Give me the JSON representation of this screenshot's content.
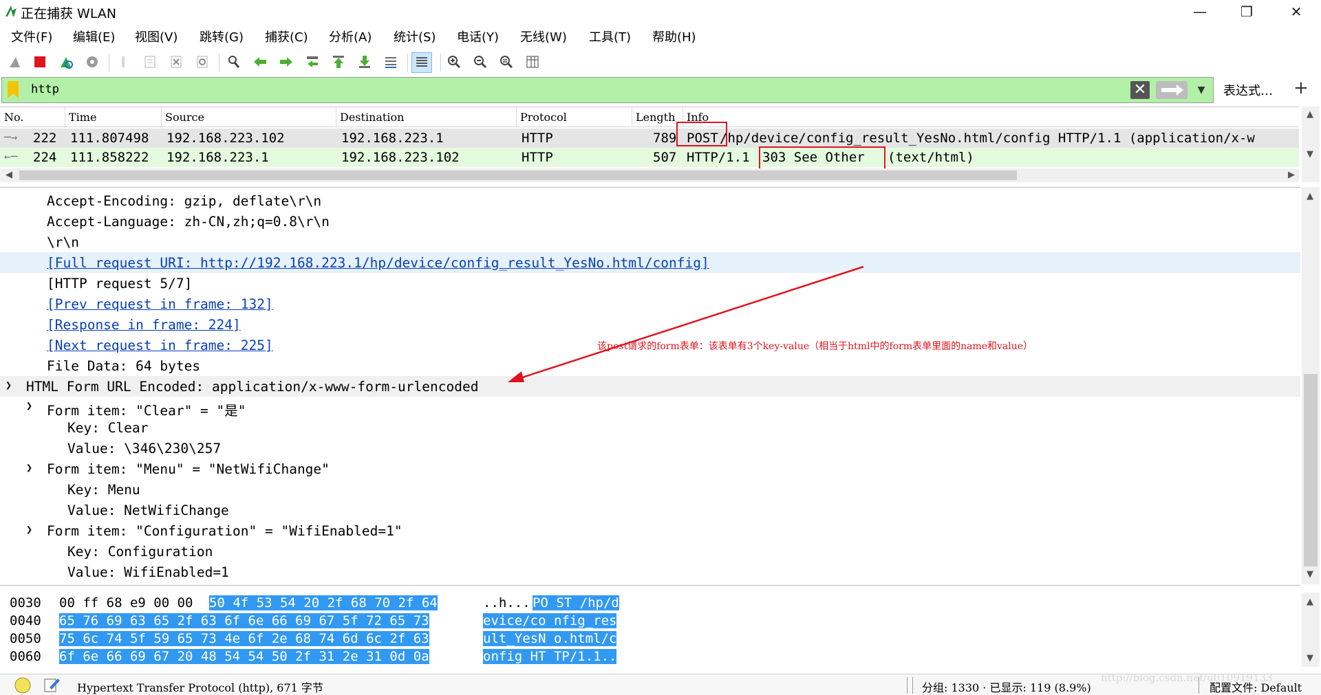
{
  "window": {
    "title": "正在捕获 WLAN",
    "minimize": "—",
    "restore": "❐",
    "close": "✕"
  },
  "menu": [
    "文件(F)",
    "编辑(E)",
    "视图(V)",
    "跳转(G)",
    "捕获(C)",
    "分析(A)",
    "统计(S)",
    "电话(Y)",
    "无线(W)",
    "工具(T)",
    "帮助(H)"
  ],
  "toolbar": {
    "icons": [
      "shark-fin-start-icon",
      "stop-capture-icon",
      "restart-capture-icon",
      "capture-options-icon",
      "open-file-icon",
      "save-file-icon",
      "close-file-icon",
      "reload-file-icon",
      "find-packet-icon",
      "go-back-icon",
      "go-forward-icon",
      "go-to-packet-icon",
      "go-first-icon",
      "go-last-icon",
      "autoscroll-icon",
      "colorize-icon",
      "zoom-in-icon",
      "zoom-out-icon",
      "zoom-normal-icon",
      "resize-columns-icon"
    ]
  },
  "filter": {
    "value": "http",
    "expression_label": "表达式…",
    "add_label": "+"
  },
  "packet_list": {
    "columns": [
      "No.",
      "Time",
      "Source",
      "Destination",
      "Protocol",
      "Length",
      "Info"
    ],
    "rows": [
      {
        "no": "222",
        "time": "111.807498",
        "source": "192.168.223.102",
        "destination": "192.168.223.1",
        "protocol": "HTTP",
        "length": "789",
        "info_method": "POST",
        "info_rest": " /hp/device/config_result_YesNo.html/config HTTP/1.1  (application/x-w"
      },
      {
        "no": "224",
        "time": "111.858222",
        "source": "192.168.223.1",
        "destination": "192.168.223.102",
        "protocol": "HTTP",
        "length": "507",
        "info_method": "HTTP/1.1",
        "info_status": "303 See Other",
        "info_rest": "(text/html)"
      }
    ]
  },
  "details": {
    "lines": [
      "Accept-Encoding: gzip, deflate\\r\\n",
      "Accept-Language: zh-CN,zh;q=0.8\\r\\n",
      "\\r\\n",
      "[Full request URI: http://192.168.223.1/hp/device/config_result_YesNo.html/config]",
      "[HTTP request 5/7]",
      "[Prev request in frame: 132]",
      "[Response in frame: 224]",
      "[Next request in frame: 225]",
      "File Data: 64 bytes",
      "HTML Form URL Encoded: application/x-www-form-urlencoded",
      "Form item: \"Clear\" = \"是\"",
      "Key: Clear",
      "Value: \\346\\230\\257",
      "Form item: \"Menu\" = \"NetWifiChange\"",
      "Key: Menu",
      "Value: NetWifiChange",
      "Form item: \"Configuration\" = \"WifiEnabled=1\"",
      "Key: Configuration",
      "Value: WifiEnabled=1"
    ],
    "annotation": "该post请求的form表单：该表单有3个key-value（相当于html中的form表单里面的name和value）"
  },
  "bytes": {
    "rows": [
      {
        "offset": "0030",
        "hex_plain": "00 ff 68 e9 00 00",
        "hex_hl": "50 4f  53 54 20 2f 68 70 2f 64",
        "ascii_plain": "..h...",
        "ascii_hl": "PO ST /hp/d"
      },
      {
        "offset": "0040",
        "hex_plain": "",
        "hex_hl": "65 76 69 63 65 2f 63 6f  6e 66 69 67 5f 72 65 73",
        "ascii_plain": "",
        "ascii_hl": "evice/co nfig_res"
      },
      {
        "offset": "0050",
        "hex_plain": "",
        "hex_hl": "75 6c 74 5f 59 65 73 4e  6f 2e 68 74 6d 6c 2f 63",
        "ascii_plain": "",
        "ascii_hl": "ult_YesN o.html/c"
      },
      {
        "offset": "0060",
        "hex_plain": "",
        "hex_hl": "6f 6e 66 69 67 20 48 54  54 50 2f 31 2e 31 0d 0a",
        "ascii_plain": "",
        "ascii_hl": "onfig HT TP/1.1.."
      }
    ]
  },
  "status": {
    "protocol_text": "Hypertext Transfer Protocol (http), 671 字节",
    "packets_text": "分组: 1330 · 已显示: 119 (8.9%)",
    "profile_text": "配置文件: Default",
    "watermark": "http://blog.csdn.net/u010919133"
  },
  "colors": {
    "filter_bg": "#b2f0a7",
    "selection": "#3299f2",
    "annotation_red": "#e0141e",
    "link_blue": "#0a3fb4"
  }
}
